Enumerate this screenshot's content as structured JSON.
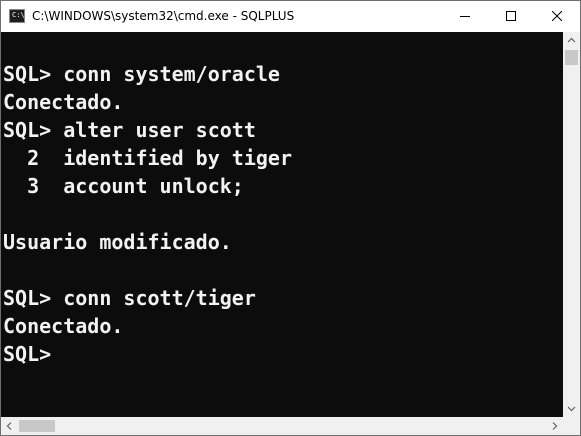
{
  "window": {
    "title": "C:\\WINDOWS\\system32\\cmd.exe - SQLPLUS",
    "app_icon": "console-app-icon",
    "app_icon_glyph": "C:\\",
    "controls": {
      "minimize_icon": "minimize-icon",
      "maximize_icon": "maximize-icon",
      "close_icon": "close-icon"
    }
  },
  "console": {
    "background": "#0c0c0c",
    "foreground": "#f2f2f2",
    "lines": [
      "",
      "SQL> conn system/oracle",
      "Conectado.",
      "SQL> alter user scott",
      "  2  identified by tiger",
      "  3  account unlock;",
      "",
      "Usuario modificado.",
      "",
      "SQL> conn scott/tiger",
      "Conectado.",
      "SQL>"
    ]
  },
  "scrollbars": {
    "vertical": {
      "up_icon": "scroll-up-arrow-icon",
      "down_icon": "scroll-down-arrow-icon"
    },
    "horizontal": {
      "left_icon": "scroll-left-arrow-icon",
      "right_icon": "scroll-right-arrow-icon"
    }
  }
}
